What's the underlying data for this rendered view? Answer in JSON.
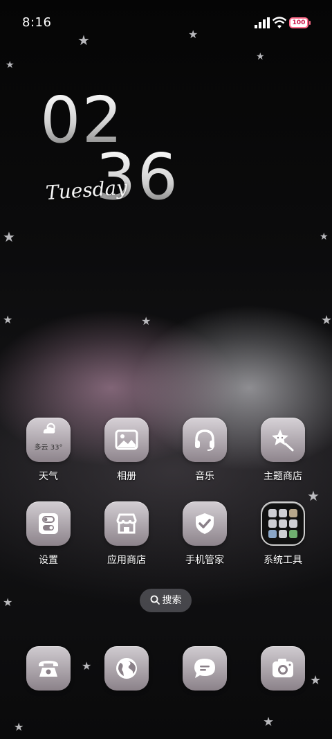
{
  "status_bar": {
    "time": "8:16",
    "battery": "100"
  },
  "clock": {
    "hours": "02",
    "minutes": "36",
    "day": "Tuesday"
  },
  "apps": [
    {
      "name": "weather",
      "label": "天气",
      "weather": "多云 33°"
    },
    {
      "name": "gallery",
      "label": "相册"
    },
    {
      "name": "music",
      "label": "音乐"
    },
    {
      "name": "theme-store",
      "label": "主题商店"
    },
    {
      "name": "settings",
      "label": "设置"
    },
    {
      "name": "app-store",
      "label": "应用商店"
    },
    {
      "name": "phone-manager",
      "label": "手机管家"
    },
    {
      "name": "system-tools",
      "label": "系统工具"
    }
  ],
  "search": {
    "label": "搜索"
  },
  "dock": [
    {
      "icon": "phone-icon"
    },
    {
      "icon": "browser-globe-icon"
    },
    {
      "icon": "messages-icon"
    },
    {
      "icon": "camera-icon"
    }
  ],
  "colors": {
    "battery_accent": "#ff6b8a",
    "icon_tile": "#c8c0c6"
  }
}
